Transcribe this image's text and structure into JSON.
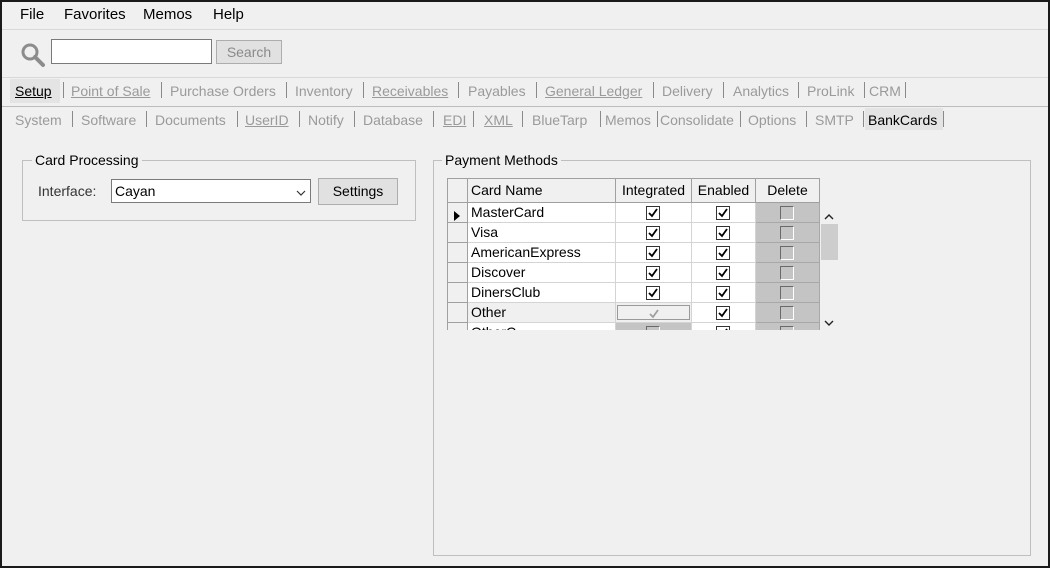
{
  "menu": [
    "File",
    "Favorites",
    "Memos",
    "Help"
  ],
  "search": {
    "placeholder": "",
    "value": "",
    "button": "Search"
  },
  "tabs_primary": [
    {
      "label": "Setup",
      "active": true
    },
    {
      "label": "Point of Sale"
    },
    {
      "label": "Purchase Orders"
    },
    {
      "label": "Inventory"
    },
    {
      "label": "Receivables"
    },
    {
      "label": "Payables"
    },
    {
      "label": "General Ledger"
    },
    {
      "label": "Delivery"
    },
    {
      "label": "Analytics"
    },
    {
      "label": "ProLink"
    },
    {
      "label": "CRM"
    }
  ],
  "tabs_secondary": [
    {
      "label": "System"
    },
    {
      "label": "Software"
    },
    {
      "label": "Documents"
    },
    {
      "label": "UserID"
    },
    {
      "label": "Notify"
    },
    {
      "label": "Database"
    },
    {
      "label": "EDI"
    },
    {
      "label": "XML"
    },
    {
      "label": "BlueTarp"
    },
    {
      "label": "Memos"
    },
    {
      "label": "Consolidate"
    },
    {
      "label": "Options"
    },
    {
      "label": "SMTP"
    },
    {
      "label": "BankCards",
      "active": true
    }
  ],
  "card_processing": {
    "title": "Card Processing",
    "interface_label": "Interface:",
    "interface_value": "Cayan",
    "settings_button": "Settings"
  },
  "payment_methods": {
    "title": "Payment Methods",
    "columns": [
      "Card Name",
      "Integrated",
      "Enabled",
      "Delete"
    ],
    "rows": [
      {
        "name": "MasterCard",
        "integrated": true,
        "enabled": true,
        "delete": false,
        "current": true
      },
      {
        "name": "Visa",
        "integrated": true,
        "enabled": true,
        "delete": false
      },
      {
        "name": "AmericanExpress",
        "integrated": true,
        "enabled": true,
        "delete": false
      },
      {
        "name": "Discover",
        "integrated": true,
        "enabled": true,
        "delete": false
      },
      {
        "name": "DinersClub",
        "integrated": true,
        "enabled": true,
        "delete": false
      },
      {
        "name": "Other",
        "integrated": true,
        "integrated_disabled": true,
        "enabled": true,
        "delete": false
      },
      {
        "name": "OtherC",
        "integrated": false,
        "enabled": true,
        "delete": false
      }
    ]
  },
  "colors": {
    "background": "#f0f0f0",
    "inactive_tab_text": "#9a9a9a",
    "delete_column": "#c4c4c4"
  },
  "icons": [
    "search-icon",
    "chevron-down-icon",
    "row-pointer-icon",
    "scroll-up-icon",
    "scroll-down-icon",
    "check-icon"
  ]
}
